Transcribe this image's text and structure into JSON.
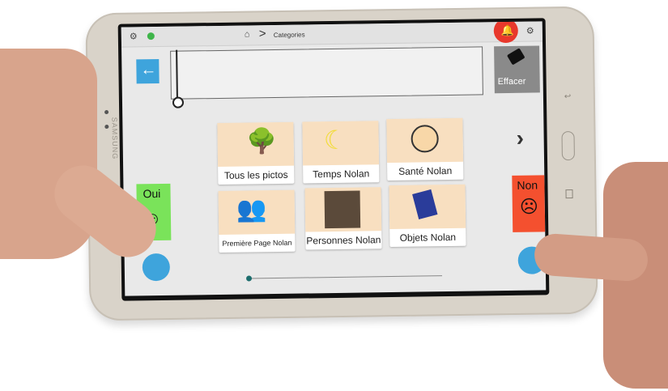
{
  "topbar": {
    "settings_icon_left": "gear-icon",
    "status_icon": "check-circle-icon",
    "home_icon": "home-icon",
    "breadcrumb_separator": ">",
    "breadcrumb_current": "Categories",
    "alert_icon": "bell-icon",
    "settings_icon_right": "gear-icon"
  },
  "toolbar": {
    "back_icon": "arrow-left-icon",
    "clear_label": "Effacer",
    "clear_icon": "eraser-icon"
  },
  "tiles": [
    {
      "label": "Tous les pictos",
      "icon": "tree-icon"
    },
    {
      "label": "Temps Nolan",
      "icon": "moon-stars-icon"
    },
    {
      "label": "Santé Nolan",
      "icon": "smiling-face-icon"
    },
    {
      "label": "Première Page Nolan",
      "icon": "people-talking-icon"
    },
    {
      "label": "Personnes Nolan",
      "icon": "person-photo-icon"
    },
    {
      "label": "Objets Nolan",
      "icon": "book-icon"
    }
  ],
  "next_page_icon": "chevron-right-icon",
  "yes_button": {
    "label": "Oui",
    "color": "#7ae35a"
  },
  "no_button": {
    "label": "Non",
    "color": "#f4502f"
  },
  "device": {
    "brand_text": "SAMSUNG"
  },
  "colors": {
    "back_button": "#3ea4dc",
    "clear_button": "#8a8a8a",
    "alert": "#e8382c",
    "tile_background": "#f8dfc0",
    "fab": "#3ea4dc"
  }
}
